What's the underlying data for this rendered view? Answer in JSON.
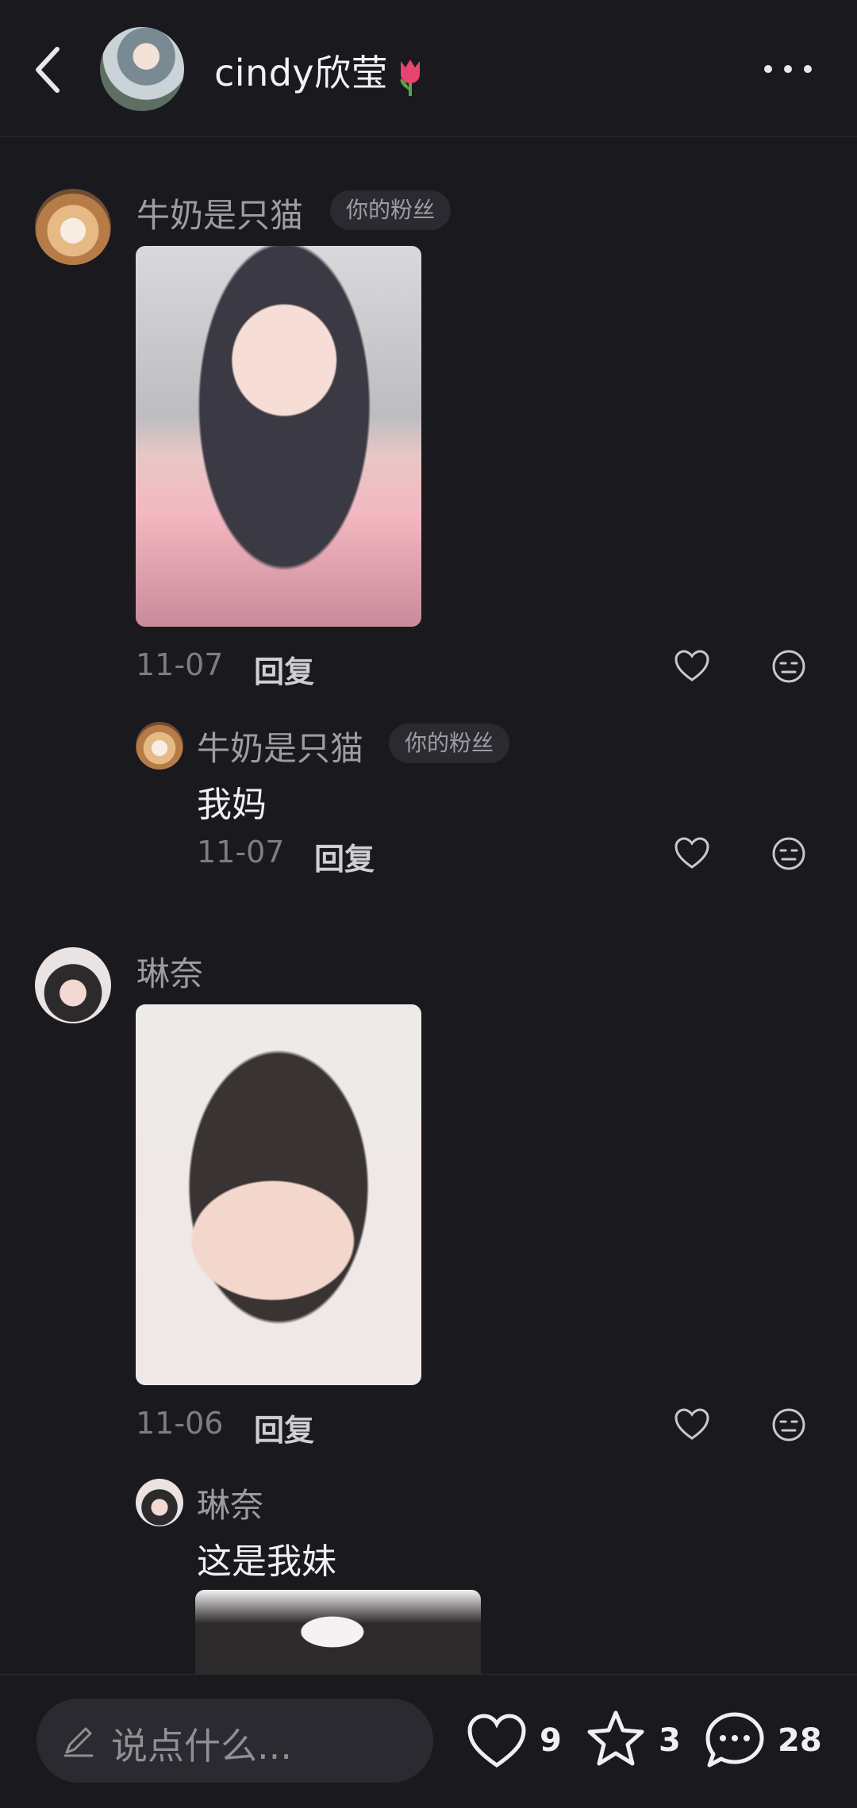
{
  "header": {
    "username": "cindy欣莹"
  },
  "comments": [
    {
      "user": "牛奶是只猫",
      "badge": "你的粉丝",
      "date": "11-07",
      "reply": "回复",
      "replies": [
        {
          "user": "牛奶是只猫",
          "badge": "你的粉丝",
          "text": "我妈",
          "date": "11-07",
          "reply": "回复"
        }
      ]
    },
    {
      "user": "琳奈",
      "date": "11-06",
      "reply": "回复",
      "replies": [
        {
          "user": "琳奈",
          "text": "这是我妹"
        }
      ]
    }
  ],
  "bottom_bar": {
    "placeholder": "说点什么...",
    "likes": "9",
    "favorites": "3",
    "comments": "28"
  }
}
